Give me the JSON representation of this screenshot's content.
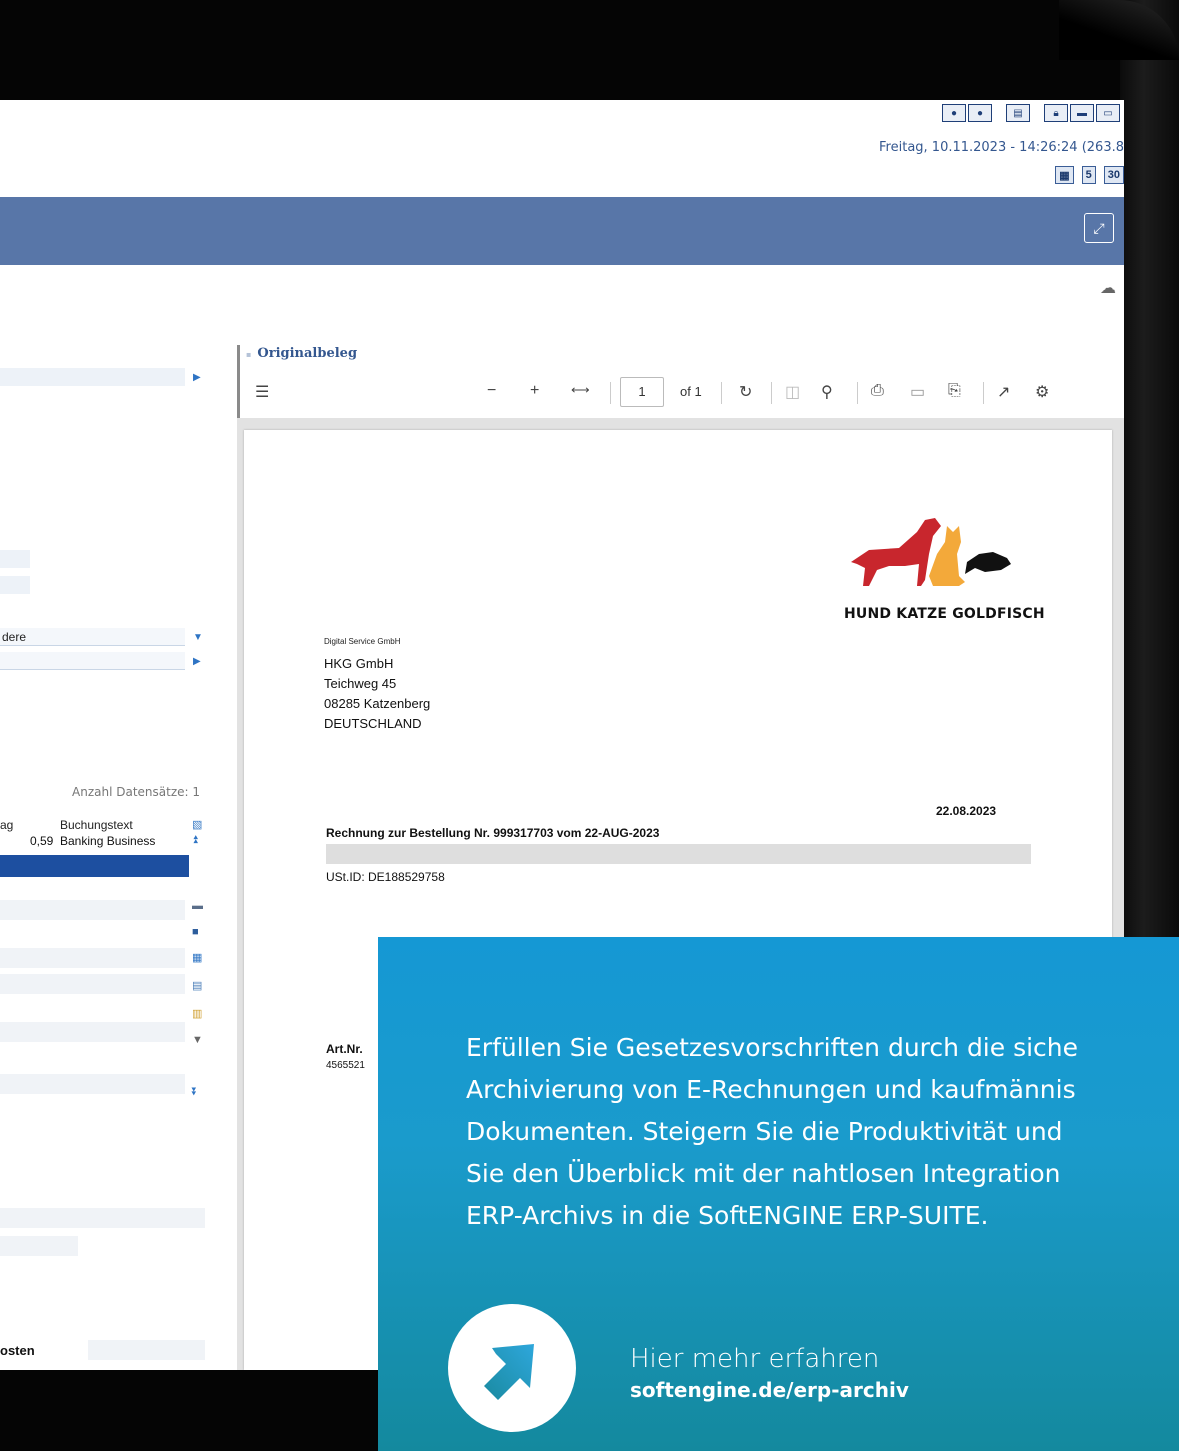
{
  "header": {
    "datetime": "Freitag, 10.11.2023 - 14:26:24 (263.8",
    "status_badges": [
      "5",
      "30"
    ]
  },
  "left_panel": {
    "field_partial": "dere",
    "record_count": "Anzahl Datensätze: 1",
    "columns": [
      "ag",
      "Buchungstext"
    ],
    "row": {
      "amount": "0,59",
      "text": "Banking Business"
    },
    "bold_label": "osten"
  },
  "viewer": {
    "title": "Originalbeleg",
    "page_current": "1",
    "page_total_label": "of 1"
  },
  "document": {
    "logo_text": "HUND KATZE GOLDFISCH",
    "sender_small": "Digital Service GmbH",
    "address": [
      "HKG GmbH",
      "Teichweg 45",
      "08285 Katzenberg",
      "DEUTSCHLAND"
    ],
    "date": "22.08.2023",
    "subject": "Rechnung zur Bestellung Nr. 999317703 vom 22-AUG-2023",
    "ust_id": "USt.ID: DE188529758",
    "art_nr_label": "Art.Nr.",
    "art_nr_value": "4565521"
  },
  "promo": {
    "lines": [
      "Erfüllen Sie Gesetzesvorschriften durch die siche",
      "Archivierung von E-Rechnungen und kaufmännis",
      "Dokumenten. Steigern Sie die Produktivität und",
      "Sie den Überblick mit der nahtlosen Integration",
      "ERP-Archivs in die SoftENGINE ERP-SUITE."
    ],
    "link_label": "Hier mehr erfahren",
    "link_url": "softengine.de/erp-archiv"
  },
  "colors": {
    "accent_blue": "#5876a8",
    "selection_blue": "#1d4fa0",
    "promo_top": "#1598d4",
    "promo_bottom": "#14899e",
    "logo_red": "#c8262d",
    "logo_orange": "#f3a93a"
  }
}
